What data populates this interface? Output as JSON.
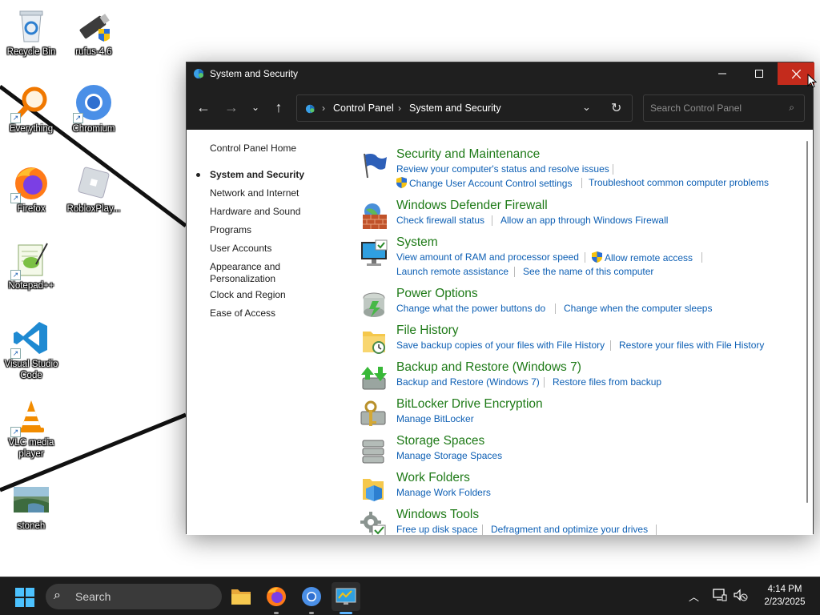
{
  "desktop": {
    "icons": [
      {
        "label": "Recycle Bin"
      },
      {
        "label": "rufus-4.6"
      },
      {
        "label": "Everything"
      },
      {
        "label": "Chromium"
      },
      {
        "label": "Firefox"
      },
      {
        "label": "RobloxPlay..."
      },
      {
        "label": "Notepad++"
      },
      {
        "label": "Visual Studio Code"
      },
      {
        "label": "VLC media player"
      },
      {
        "label": "stoneh"
      }
    ]
  },
  "window": {
    "title": "System and Security",
    "breadcrumb": [
      "Control Panel",
      "System and Security"
    ],
    "search_placeholder": "Search Control Panel",
    "left_nav": {
      "home": "Control Panel Home",
      "items": [
        "System and Security",
        "Network and Internet",
        "Hardware and Sound",
        "Programs",
        "User Accounts",
        "Appearance and Personalization",
        "Clock and Region",
        "Ease of Access"
      ],
      "active_index": 0
    },
    "sections": [
      {
        "title": "Security and Maintenance",
        "icon": "flag-icon",
        "links": [
          "Review your computer's status and resolve issues",
          "Change User Account Control settings",
          "Troubleshoot common computer problems"
        ]
      },
      {
        "title": "Windows Defender Firewall",
        "icon": "firewall-icon",
        "links": [
          "Check firewall status",
          "Allow an app through Windows Firewall"
        ]
      },
      {
        "title": "System",
        "icon": "computer-icon",
        "links": [
          "View amount of RAM and processor speed",
          "Allow remote access",
          "Launch remote assistance",
          "See the name of this computer"
        ]
      },
      {
        "title": "Power Options",
        "icon": "power-icon",
        "links": [
          "Change what the power buttons do",
          "Change when the computer sleeps"
        ]
      },
      {
        "title": "File History",
        "icon": "file-history-icon",
        "links": [
          "Save backup copies of your files with File History",
          "Restore your files with File History"
        ]
      },
      {
        "title": "Backup and Restore (Windows 7)",
        "icon": "backup-icon",
        "links": [
          "Backup and Restore (Windows 7)",
          "Restore files from backup"
        ]
      },
      {
        "title": "BitLocker Drive Encryption",
        "icon": "bitlocker-icon",
        "links": [
          "Manage BitLocker"
        ]
      },
      {
        "title": "Storage Spaces",
        "icon": "storage-icon",
        "links": [
          "Manage Storage Spaces"
        ]
      },
      {
        "title": "Work Folders",
        "icon": "work-folders-icon",
        "links": [
          "Manage Work Folders"
        ]
      },
      {
        "title": "Windows Tools",
        "icon": "tools-icon",
        "links": [
          "Free up disk space",
          "Defragment and optimize your drives"
        ]
      }
    ]
  },
  "taskbar": {
    "search_label": "Search",
    "clock_time": "4:14 PM",
    "clock_date": "2/23/2025"
  },
  "colors": {
    "section_title": "#1e7a17",
    "link": "#0d5fb4",
    "titlebar": "#1f1f1f",
    "close_hover": "#c42b1c",
    "taskbar": "#1c1c1c"
  }
}
